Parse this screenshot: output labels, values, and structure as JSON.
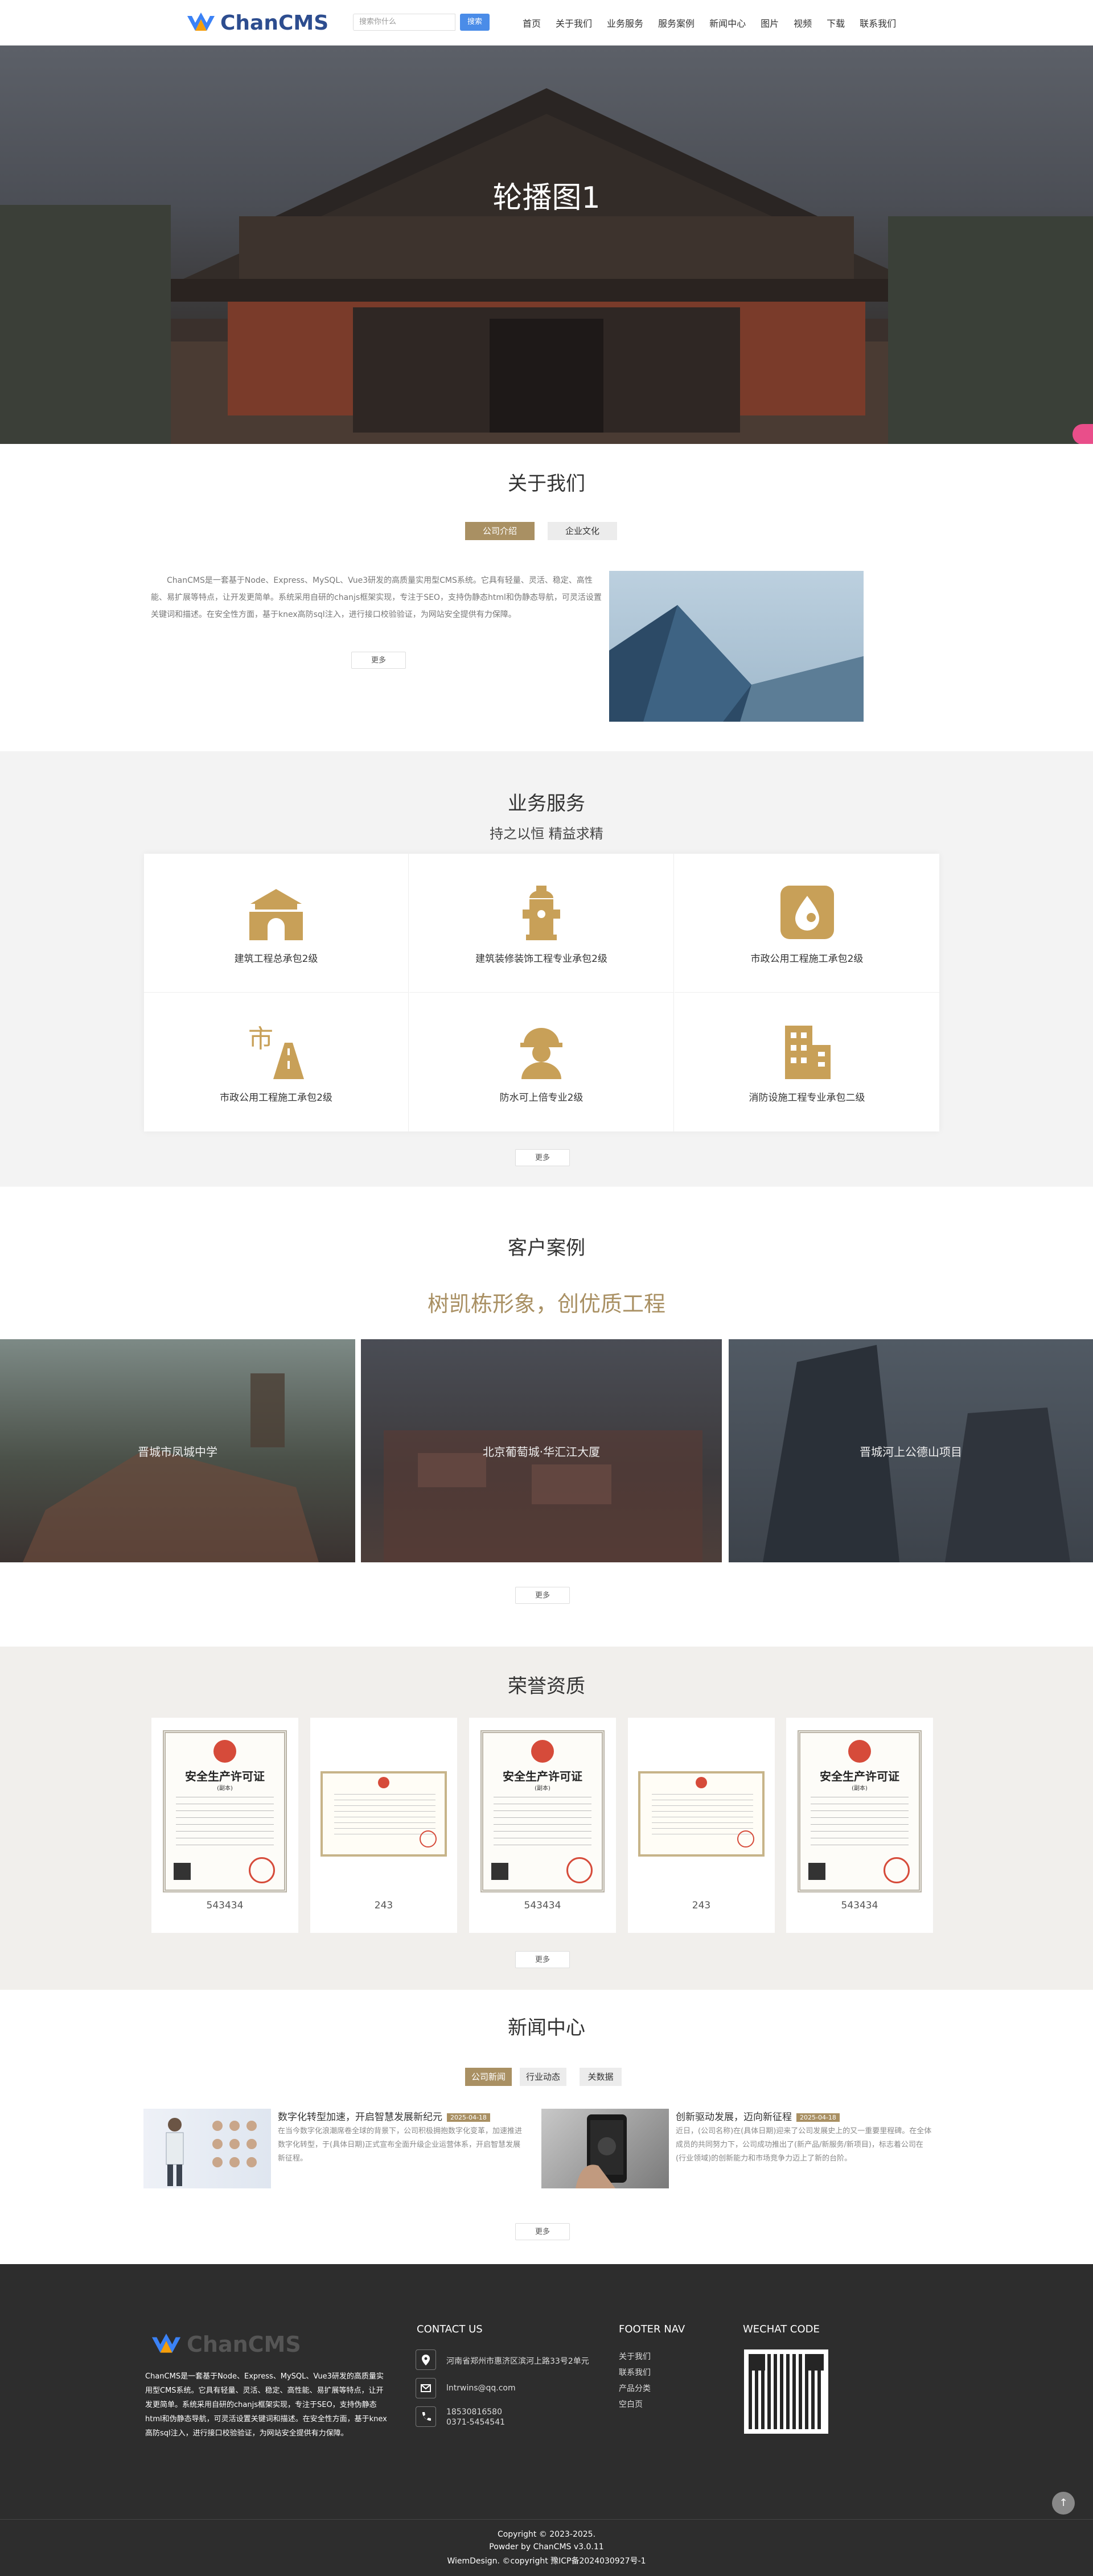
{
  "header": {
    "logo_text": "ChanCMS",
    "search_placeholder": "搜索你什么",
    "search_button": "搜索",
    "nav": [
      "首页",
      "关于我们",
      "业务服务",
      "服务案例",
      "新闻中心",
      "图片",
      "视频",
      "下载",
      "联系我们"
    ]
  },
  "banner": {
    "title": "轮播图1"
  },
  "about": {
    "title": "关于我们",
    "tabs": [
      "公司介绍",
      "企业文化"
    ],
    "text": "ChanCMS是一套基于Node、Express、MySQL、Vue3研发的高质量实用型CMS系统。它具有轻量、灵活、稳定、高性能、易扩展等特点，让开发更简单。系统采用自研的chanjs框架实现，专注于SEO，支持伪静态html和伪静态导航，可灵活设置关键词和描述。在安全性方面，基于knex高防sql注入，进行接口校验验证，为网站安全提供有力保障。",
    "more": "更多"
  },
  "services": {
    "title": "业务服务",
    "subtitle": "持之以恒 精益求精",
    "items": [
      {
        "label": "建筑工程总承包2级",
        "icon": "gate-icon"
      },
      {
        "label": "建筑装修装饰工程专业承包2级",
        "icon": "hydrant-icon"
      },
      {
        "label": "市政公用工程施工承包2级",
        "icon": "water-drop-icon"
      },
      {
        "label": "市政公用工程施工承包2级",
        "icon": "road-icon"
      },
      {
        "label": "防水可上倍专业2级",
        "icon": "worker-icon"
      },
      {
        "label": "消防设施工程专业承包二级",
        "icon": "buildings-icon"
      }
    ],
    "more": "更多"
  },
  "cases": {
    "title": "客户案例",
    "slogan": "树凯栋形象，创优质工程",
    "items": [
      "晋城市凤城中学",
      "北京葡萄城·华汇江大厦",
      "晋城河上公德山项目"
    ],
    "more": "更多"
  },
  "honors": {
    "title": "荣誉资质",
    "cert_heading": "安全生产许可证",
    "cert_sub": "(副本)",
    "items": [
      "543434",
      "243",
      "543434",
      "243",
      "543434"
    ],
    "more": "更多"
  },
  "news": {
    "title": "新闻中心",
    "tabs": [
      "公司新闻",
      "行业动态",
      "关数据"
    ],
    "items": [
      {
        "title": "数字化转型加速，开启智慧发展新纪元",
        "date": "2025-04-18",
        "desc": "在当今数字化浪潮席卷全球的背景下，公司积极拥抱数字化变革，加速推进数字化转型，于(具体日期)正式宣布全面升级企业运营体系，开启智慧发展新征程。"
      },
      {
        "title": "创新驱动发展，迈向新征程",
        "date": "2025-04-18",
        "desc": "近日，(公司名称)在(具体日期)迎来了公司发展史上的又一重要里程碑。在全体成员的共同努力下，公司成功推出了(新产品/新服务/新项目)，标志着公司在(行业领域)的创新能力和市场竞争力迈上了新的台阶。"
      }
    ],
    "more": "更多"
  },
  "footer": {
    "logo_text": "ChanCMS",
    "about": "ChanCMS是一套基于Node、Express、MySQL、Vue3研发的高质量实用型CMS系统。它具有轻量、灵活、稳定、高性能、易扩展等特点，让开发更简单。系统采用自研的chanjs框架实现，专注于SEO，支持伪静态html和伪静态导航，可灵活设置关键词和描述。在安全性方面，基于knex高防sql注入，进行接口校验验证，为网站安全提供有力保障。",
    "contact_title": "CONTACT US",
    "address": "河南省郑州市惠济区滨河上路33号2单元",
    "email": "lntrwins@qq.com",
    "phone1": "18530816580",
    "phone2": "0371-5454541",
    "nav_title": "FOOTER NAV",
    "nav": [
      "关于我们",
      "联系我们",
      "产品分类",
      "空白页"
    ],
    "wechat_title": "WECHAT CODE",
    "copyright1": "Copyright © 2023-2025.",
    "copyright2": "Powder by ChanCMS v3.0.11",
    "copyright3": "WiemDesign.   ©copyright 豫ICP备2024030927号-1",
    "back_top": "↑"
  }
}
